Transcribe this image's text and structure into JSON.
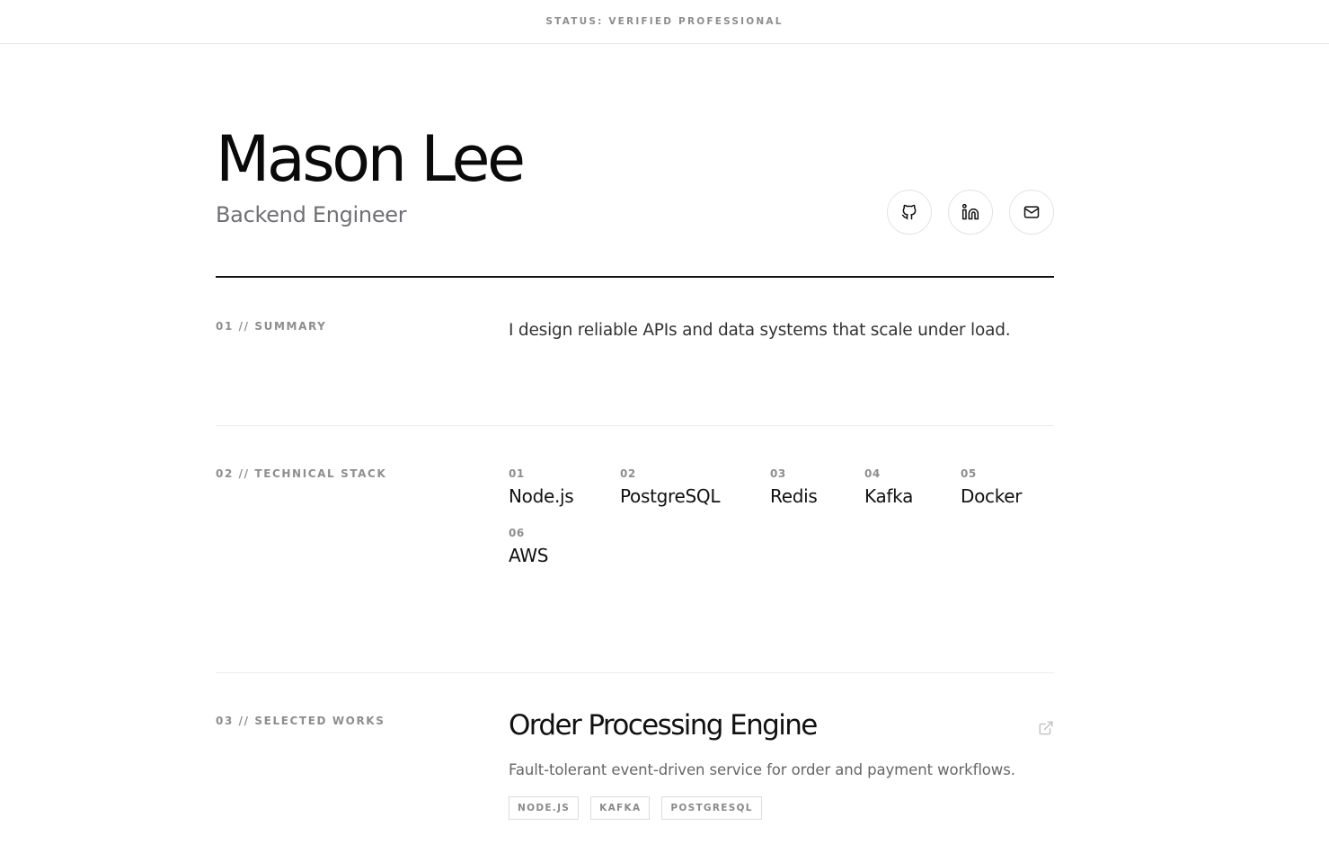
{
  "status": {
    "text": "STATUS: VERIFIED PROFESSIONAL"
  },
  "profile": {
    "name": "Mason Lee",
    "role": "Backend Engineer"
  },
  "socials": [
    {
      "icon": "github-icon"
    },
    {
      "icon": "linkedin-icon"
    },
    {
      "icon": "mail-icon"
    }
  ],
  "sections": {
    "summary": {
      "label": "01 // SUMMARY",
      "text": "I design reliable APIs and data systems that scale under load."
    },
    "stack": {
      "label": "02 // TECHNICAL STACK",
      "items": [
        {
          "num": "01",
          "name": "Node.js"
        },
        {
          "num": "02",
          "name": "PostgreSQL"
        },
        {
          "num": "03",
          "name": "Redis"
        },
        {
          "num": "04",
          "name": "Kafka"
        },
        {
          "num": "05",
          "name": "Docker"
        },
        {
          "num": "06",
          "name": "AWS"
        }
      ]
    },
    "works": {
      "label": "03 // SELECTED WORKS",
      "projects": [
        {
          "title": "Order Processing Engine",
          "description": "Fault-tolerant event-driven service for order and payment workflows.",
          "tags": [
            "NODE.JS",
            "KAFKA",
            "POSTGRESQL"
          ],
          "link_icon": "external-link-icon"
        }
      ]
    }
  },
  "colors": {
    "text": "#111111",
    "muted": "#8e8e8e",
    "divider": "#111111"
  }
}
